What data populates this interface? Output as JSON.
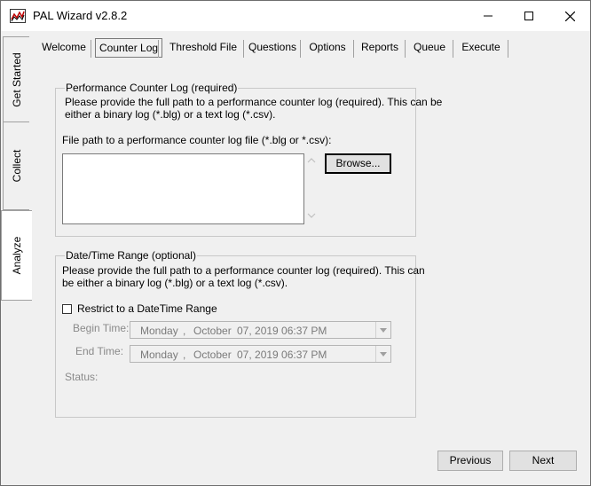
{
  "window": {
    "title": "PAL Wizard v2.8.2"
  },
  "side_tabs": [
    {
      "label": "Get Started"
    },
    {
      "label": "Collect"
    },
    {
      "label": "Analyze"
    }
  ],
  "tabs": [
    {
      "label": "Welcome"
    },
    {
      "label": "Counter Log"
    },
    {
      "label": "Threshold File"
    },
    {
      "label": "Questions"
    },
    {
      "label": "Options"
    },
    {
      "label": "Reports"
    },
    {
      "label": "Queue"
    },
    {
      "label": "Execute"
    }
  ],
  "counter_log_group": {
    "legend": "Performance Counter Log (required)",
    "description_line1": "Please provide the full path to a performance counter log (required). This can be",
    "description_line2": "either a binary log (*.blg) or a text log (*.csv).",
    "file_path_label": "File path to a performance counter log file (*.blg or *.csv):",
    "file_path_value": "",
    "browse_label": "Browse..."
  },
  "date_range_group": {
    "legend": "Date/Time Range (optional)",
    "description_line1": "Please provide the full path to a performance counter log (required). This can",
    "description_line2": "be either a binary log (*.blg) or a text log (*.csv).",
    "restrict_label": "Restrict to a DateTime Range",
    "restrict_checked": false,
    "begin_label": "Begin Time:",
    "begin_day": "Monday",
    "begin_comma": ",",
    "begin_month": "October",
    "begin_rest": "07, 2019 06:37 PM",
    "end_label": "End Time:",
    "end_day": "Monday",
    "end_comma": ",",
    "end_month": "October",
    "end_rest": "07, 2019 06:37 PM",
    "status_label": "Status:"
  },
  "footer": {
    "previous_label": "Previous",
    "next_label": "Next"
  },
  "colors": {
    "window_bg": "#f0f0f0",
    "titlebar_bg": "#ffffff",
    "border": "#a0a0a0"
  }
}
